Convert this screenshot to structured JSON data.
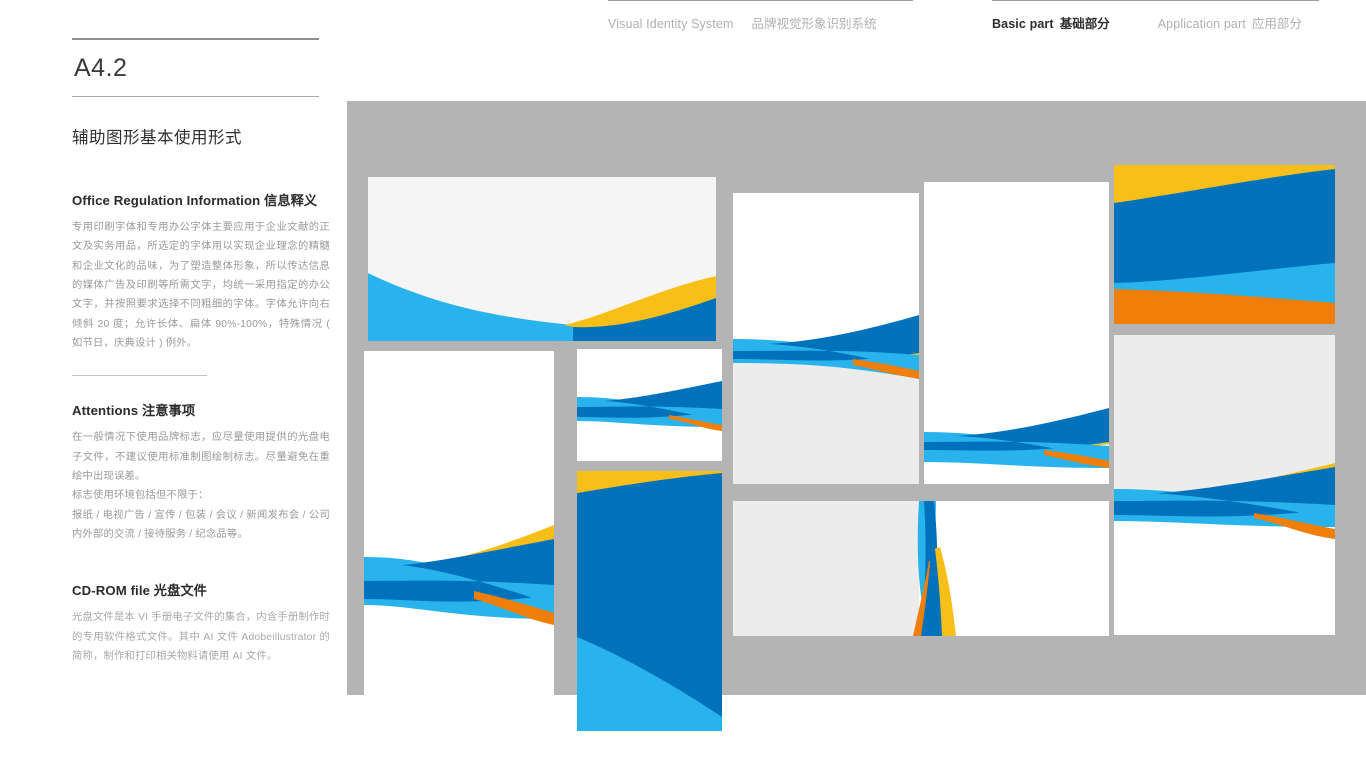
{
  "header": {
    "visual_identity_en": "Visual Identity System",
    "visual_identity_cn": "品牌视觉形象识别系统",
    "basic_part_en": "Basic part",
    "basic_part_cn": "基础部分",
    "application_part_en": "Application part",
    "application_part_cn": "应用部分"
  },
  "left": {
    "page_code": "A4.2",
    "section_title": "辅助图形基本使用形式",
    "office": {
      "heading_en": "Office Regulation Information",
      "heading_cn": "信息释义",
      "body": "专用印刷字体和专用办公字体主要应用于企业文献的正文及实务用品，所选定的字体用以实现企业理念的精髓和企业文化的品味，为了塑造整体形象，所以传达信息的媒体广告及印刷等所需文字，均统一采用指定的办公文字，并按照要求选择不同粗细的字体。字体允许向右倾斜 20 度；允许长体、扁体 90%-100%，特殊情况 ( 如节日，庆典设计 ) 例外。"
    },
    "attentions": {
      "heading_en": "Attentions",
      "heading_cn": "注意事项",
      "body_1": "在一般情况下使用品牌标志，应尽量使用提供的光盘电子文件，不建议使用标准制图绘制标志。尽量避免在重绘中出现误差。",
      "body_2": "标志使用环境包括但不限于：",
      "body_3": "报纸 / 电视广告 / 宣传 / 包装 / 会议 / 新闻发布会 / 公司内外部的交流 / 接待服务 / 纪念品等。"
    },
    "cdrom": {
      "heading_en": "CD-ROM file",
      "heading_cn": "光盘文件",
      "body": "光盘文件是本 VI 手册电子文件的集合，内含手册制作时的专用软件格式文件。其中 AI 文件 Adobeillustrator 的简称，制作和打印相关物料请使用 AI 文件。"
    }
  },
  "colors": {
    "canvas_background": "#b4b4b4",
    "panel_white": "#ffffff",
    "panel_offwhite": "#f5f5f5",
    "panel_grey": "#ececec",
    "brand_blue_dark": "#0072bc",
    "brand_blue_light": "#29b3ec",
    "brand_yellow": "#f9bf19",
    "brand_orange": "#ef7f08",
    "text_dark": "#2e2e2e",
    "text_muted": "#9a9a9a",
    "rule": "#a9a9a9"
  },
  "panels": [
    {
      "name": "poster-landscape-large",
      "style": "wave-bottom-light"
    },
    {
      "name": "poster-portrait-grey-bottom",
      "style": "ribbon-cross-mid"
    },
    {
      "name": "poster-portrait-plain",
      "style": "ribbon-cross-low"
    },
    {
      "name": "poster-landscape-full-color",
      "style": "full-bleed-bands"
    },
    {
      "name": "poster-portrait-tall-left",
      "style": "ribbon-cross-wide"
    },
    {
      "name": "poster-small-landscape",
      "style": "ribbon-cross-small"
    },
    {
      "name": "poster-blue-block",
      "style": "blue-dominant"
    },
    {
      "name": "poster-wide-twist",
      "style": "vertical-twist"
    },
    {
      "name": "poster-portrait-right",
      "style": "ribbon-cross-grey-top"
    }
  ]
}
